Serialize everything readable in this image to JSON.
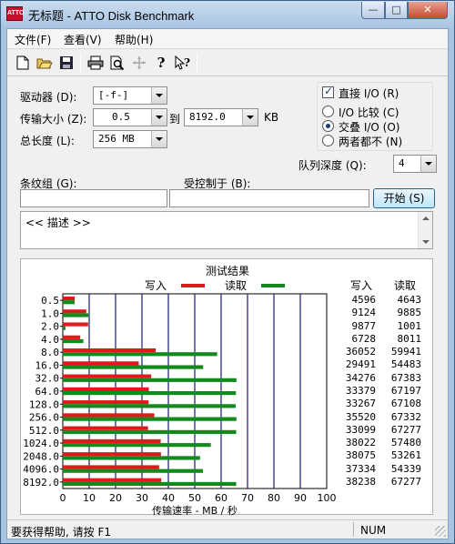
{
  "window": {
    "title": "无标题 - ATTO Disk Benchmark",
    "icon_text": "ATTO"
  },
  "controls": {
    "minimize": "—",
    "maximize": "□",
    "close": "✕"
  },
  "menu": [
    {
      "label": "文件(F)"
    },
    {
      "label": "查看(V)"
    },
    {
      "label": "帮助(H)"
    }
  ],
  "toolbar": {
    "icons": [
      "new-file-icon",
      "open-folder-icon",
      "save-icon",
      "print-icon",
      "print-preview-icon",
      "move-icon",
      "help-icon",
      "context-help-icon"
    ]
  },
  "form": {
    "drive_label": "驱动器 (D):",
    "drive_value": "[-f-]",
    "transfer_label": "传输大小 (Z):",
    "transfer_from": "0.5",
    "to_label": "到",
    "transfer_to": "8192.0",
    "kb_label": "KB",
    "total_label": "总长度 (L):",
    "total_value": "256 MB",
    "direct_io_label": "直接 I/O (R)",
    "direct_io_checked": true,
    "io_compare_label": "I/O 比较 (C)",
    "io_overlap_label": "交叠 I/O (O)",
    "io_neither_label": "两者都不 (N)",
    "selected_io": "overlap",
    "queue_label": "队列深度 (Q):",
    "queue_value": "4",
    "stripe_label": "条纹组 (G):",
    "stripe_value": "",
    "controlled_label": "受控制于 (B):",
    "controlled_value": "",
    "start_button": "开始 (S)",
    "description": "<< 描述 >>"
  },
  "results": {
    "title": "测试结果",
    "write_legend": "写入",
    "read_legend": "读取",
    "write_col": "写入",
    "read_col": "读取",
    "x_axis_label": "传输速率 - MB / 秒",
    "write_color": "#e01a1a",
    "read_color": "#138a1c"
  },
  "chart_data": {
    "type": "bar",
    "orientation": "horizontal",
    "title": "测试结果",
    "xlabel": "传输速率 - MB / 秒",
    "ylabel": "",
    "xlim": [
      0,
      100
    ],
    "xticks": [
      0,
      10,
      20,
      30,
      40,
      50,
      60,
      70,
      80,
      90,
      100
    ],
    "grid": true,
    "categories": [
      "0.5",
      "1.0",
      "2.0",
      "4.0",
      "8.0",
      "16.0",
      "32.0",
      "64.0",
      "128.0",
      "256.0",
      "512.0",
      "1024.0",
      "2048.0",
      "4096.0",
      "8192.0"
    ],
    "series": [
      {
        "name": "写入",
        "values": [
          4.5,
          8.9,
          9.6,
          6.6,
          35.2,
          28.8,
          33.5,
          32.6,
          32.5,
          34.7,
          32.3,
          37.1,
          37.2,
          36.5,
          37.3
        ]
      },
      {
        "name": "读取",
        "values": [
          4.5,
          9.7,
          1.0,
          7.8,
          58.5,
          53.2,
          65.8,
          65.6,
          65.5,
          65.8,
          65.7,
          56.1,
          52.0,
          53.1,
          65.7
        ]
      }
    ],
    "write_kbps": [
      "4596",
      "9124",
      "9877",
      "6728",
      "36052",
      "29491",
      "34276",
      "33379",
      "33267",
      "35520",
      "33099",
      "38022",
      "38075",
      "37334",
      "38238"
    ],
    "read_kbps": [
      "4643",
      "9885",
      "1001",
      "8011",
      "59941",
      "54483",
      "67383",
      "67197",
      "67108",
      "67332",
      "67277",
      "57480",
      "53261",
      "54339",
      "67277"
    ]
  },
  "status": {
    "help_text": "要获得帮助, 请按 F1",
    "num": "NUM"
  }
}
